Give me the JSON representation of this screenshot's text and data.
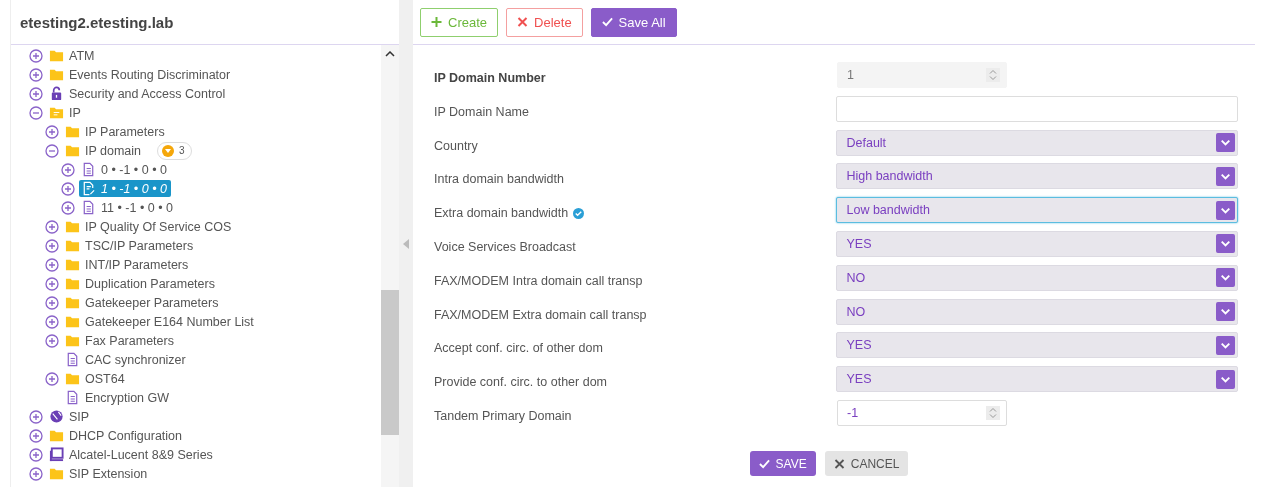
{
  "tree": {
    "title": "etesting2.etesting.lab",
    "items": [
      {
        "label": "ATM",
        "kind": "folder",
        "expandable": true,
        "expanded": false,
        "selected": false
      },
      {
        "label": "Events Routing Discriminator",
        "kind": "folder",
        "expandable": true,
        "expanded": false,
        "selected": false
      },
      {
        "label": "Security and Access Control",
        "kind": "lock",
        "expandable": true,
        "expanded": false,
        "selected": false
      },
      {
        "label": "IP",
        "kind": "folder-open",
        "expandable": true,
        "expanded": true,
        "selected": false,
        "children": [
          {
            "label": "IP Parameters",
            "kind": "folder",
            "expandable": true,
            "expanded": false,
            "selected": false
          },
          {
            "label": "IP domain",
            "kind": "folder",
            "expandable": true,
            "expanded": true,
            "selected": false,
            "badge": "3",
            "children": [
              {
                "label": "0 • -1 • 0 • 0",
                "kind": "document",
                "expandable": true,
                "expanded": false,
                "selected": false
              },
              {
                "label": "1 • -1 • 0 • 0",
                "kind": "document-edit",
                "expandable": true,
                "expanded": false,
                "selected": true
              },
              {
                "label": "11 • -1 • 0 • 0",
                "kind": "document",
                "expandable": true,
                "expanded": false,
                "selected": false
              }
            ]
          },
          {
            "label": "IP Quality Of Service COS",
            "kind": "folder",
            "expandable": true,
            "expanded": false,
            "selected": false
          },
          {
            "label": "TSC/IP Parameters",
            "kind": "folder",
            "expandable": true,
            "expanded": false,
            "selected": false
          },
          {
            "label": "INT/IP Parameters",
            "kind": "folder",
            "expandable": true,
            "expanded": false,
            "selected": false
          },
          {
            "label": "Duplication Parameters",
            "kind": "folder",
            "expandable": true,
            "expanded": false,
            "selected": false
          },
          {
            "label": "Gatekeeper Parameters",
            "kind": "folder",
            "expandable": true,
            "expanded": false,
            "selected": false
          },
          {
            "label": "Gatekeeper E164 Number List",
            "kind": "folder",
            "expandable": true,
            "expanded": false,
            "selected": false
          },
          {
            "label": "Fax Parameters",
            "kind": "folder",
            "expandable": true,
            "expanded": false,
            "selected": false
          },
          {
            "label": "CAC synchronizer",
            "kind": "document",
            "expandable": false,
            "selected": false
          },
          {
            "label": "OST64",
            "kind": "folder",
            "expandable": true,
            "expanded": false,
            "selected": false
          },
          {
            "label": "Encryption GW",
            "kind": "document",
            "expandable": false,
            "selected": false
          }
        ]
      },
      {
        "label": "SIP",
        "kind": "sip",
        "expandable": true,
        "expanded": false,
        "selected": false
      },
      {
        "label": "DHCP Configuration",
        "kind": "folder",
        "expandable": true,
        "expanded": false,
        "selected": false
      },
      {
        "label": "Alcatel-Lucent 8&9 Series",
        "kind": "monitor",
        "expandable": true,
        "expanded": false,
        "selected": false
      },
      {
        "label": "SIP Extension",
        "kind": "folder",
        "expandable": true,
        "expanded": false,
        "selected": false
      }
    ]
  },
  "toolbar": [
    {
      "label": "Create",
      "kind": "create"
    },
    {
      "label": "Delete",
      "kind": "delete"
    },
    {
      "label": "Save All",
      "kind": "save"
    }
  ],
  "form": {
    "fields": [
      {
        "label": "IP Domain Number",
        "kind": "number",
        "value": "1",
        "bold": true,
        "disabled": true,
        "focused": false,
        "verified": false
      },
      {
        "label": "IP Domain Name",
        "kind": "text",
        "bold": false,
        "disabled": false,
        "focused": false,
        "verified": false
      },
      {
        "label": "Country",
        "kind": "select",
        "value": "Default",
        "bold": false,
        "disabled": false,
        "focused": false,
        "verified": false
      },
      {
        "label": "Intra domain bandwidth",
        "kind": "select",
        "value": "High bandwidth",
        "bold": false,
        "disabled": false,
        "focused": false,
        "verified": false
      },
      {
        "label": "Extra domain bandwidth",
        "kind": "select",
        "value": "Low bandwidth",
        "bold": false,
        "disabled": false,
        "focused": true,
        "verified": true
      },
      {
        "label": "Voice Services Broadcast",
        "kind": "select",
        "value": "YES",
        "bold": false,
        "disabled": false,
        "focused": false,
        "verified": false
      },
      {
        "label": "FAX/MODEM Intra domain call transp",
        "kind": "select",
        "value": "NO",
        "bold": false,
        "disabled": false,
        "focused": false,
        "verified": false
      },
      {
        "label": "FAX/MODEM Extra domain call transp",
        "kind": "select",
        "value": "NO",
        "bold": false,
        "disabled": false,
        "focused": false,
        "verified": false
      },
      {
        "label": "Accept conf. circ. of other dom",
        "kind": "select",
        "value": "YES",
        "bold": false,
        "disabled": false,
        "focused": false,
        "verified": false
      },
      {
        "label": "Provide conf. circ. to other dom",
        "kind": "select",
        "value": "YES",
        "bold": false,
        "disabled": false,
        "focused": false,
        "verified": false
      },
      {
        "label": "Tandem Primary Domain",
        "kind": "number",
        "value": "-1",
        "bold": false,
        "disabled": false,
        "focused": false,
        "verified": false
      }
    ]
  },
  "footer": [
    {
      "label": "SAVE",
      "kind": "save"
    },
    {
      "label": "CANCEL",
      "kind": "cancel"
    }
  ]
}
